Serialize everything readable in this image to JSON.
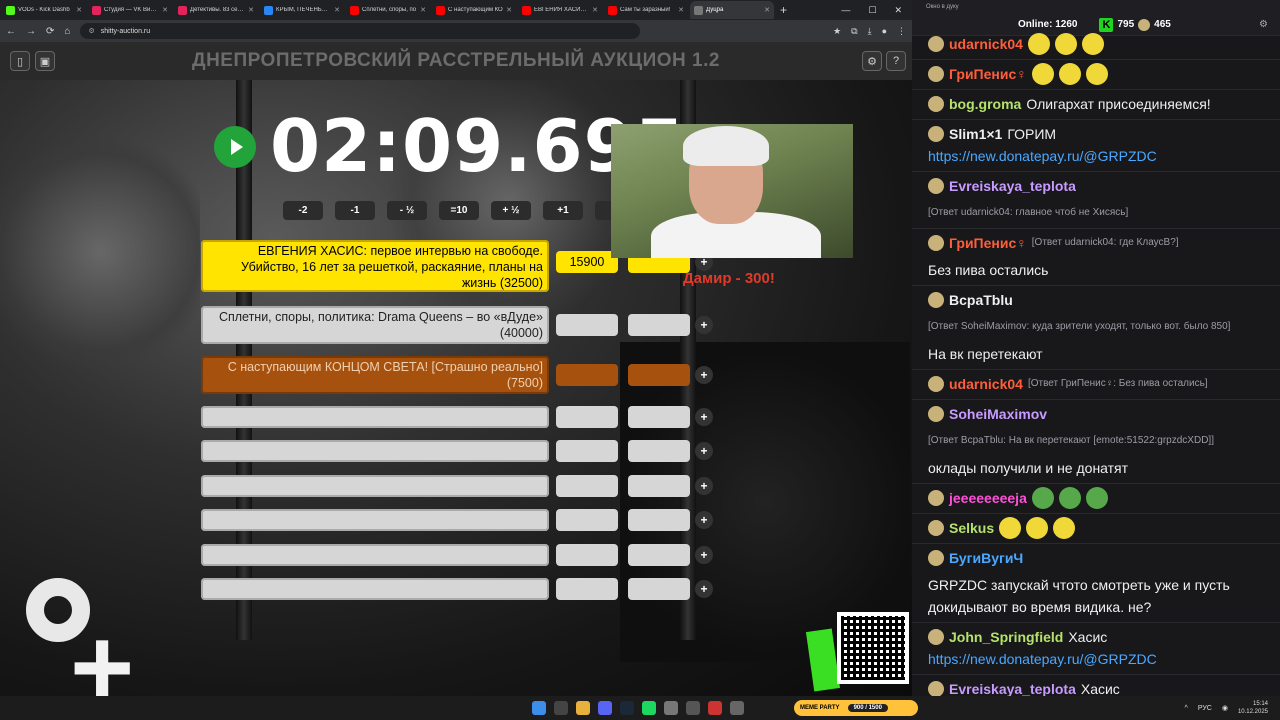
{
  "browser": {
    "tabs": [
      {
        "title": "VODs - Kick Dashb",
        "color": "#53fc18"
      },
      {
        "title": "Студия — VK Видео",
        "color": "#e3245c"
      },
      {
        "title": "Детективы. 83 серия",
        "color": "#e3245c"
      },
      {
        "title": "КРЫМ, ПЕЧЕНЬКИ В",
        "color": "#2787f5"
      },
      {
        "title": "Сплетни, споры, по",
        "color": "#ff0000"
      },
      {
        "title": "С наступающим КО",
        "color": "#ff0000"
      },
      {
        "title": "ЕВГЕНИЯ ХАСИС: п",
        "color": "#ff0000"
      },
      {
        "title": "Сам ты заразный!",
        "color": "#ff0000"
      },
      {
        "title": "Дуцра",
        "color": "#777777"
      }
    ],
    "url": "shitty-auction.ru"
  },
  "app": {
    "title": "ДНЕПРОПЕТРОВСКИЙ РАССТРЕЛЬНЫЙ АУКЦИОН 1.2",
    "timer": "02:09.695",
    "steps": [
      "-2",
      "-1",
      "- ½",
      "=10",
      "+ ½",
      "+1",
      "+"
    ],
    "overlay_text": "Дамир - 300!",
    "lots": [
      {
        "text": "ЕВГЕНИЯ ХАСИС: первое интервью на свободе. Убийство, 16 лет за решеткой, раскаяние, планы на жизнь (32500)",
        "amount": "15900",
        "style": "yellow"
      },
      {
        "text": "Сплетни, споры, политика: Drama Queens – во «вДуде» (40000)",
        "amount": "",
        "style": "grey"
      },
      {
        "text": "С наступающим КОНЦОМ СВЕТА! [Страшно реально] (7500)",
        "amount": "",
        "style": "brown"
      },
      {
        "text": "",
        "amount": "",
        "style": "grey"
      },
      {
        "text": "",
        "amount": "",
        "style": "grey"
      },
      {
        "text": "",
        "amount": "",
        "style": "grey"
      },
      {
        "text": "",
        "amount": "",
        "style": "grey"
      },
      {
        "text": "",
        "amount": "",
        "style": "grey"
      },
      {
        "text": "",
        "amount": "",
        "style": "grey"
      }
    ]
  },
  "chat": {
    "window_title": "Окно в дуку",
    "online_label": "Online: 1260",
    "kick_count": "795",
    "other_count": "465",
    "messages": [
      {
        "user": "udarnick04",
        "color": "#ff5e3a",
        "reply": "",
        "text": ""
      },
      {
        "user": "ГриПенис♀",
        "color": "#ff5e3a",
        "reply": "",
        "text": ""
      },
      {
        "user": "bog.groma",
        "color": "#b5e26a",
        "reply": "",
        "text": "Олигархат присоединяемся!"
      },
      {
        "user": "Slim1×1",
        "color": "#efeff1",
        "reply": "",
        "text": "ГОРИМ",
        "link": "https://new.donatepay.ru/@GRPZDC"
      },
      {
        "user": "Evreiskaya_teplota",
        "color": "#c79bff",
        "reply": "[Ответ udarnick04: главное чтоб не Хисясь]",
        "text": ""
      },
      {
        "user": "ГриПенис♀",
        "color": "#ff5e3a",
        "reply": "[Ответ udarnick04: где КлаусВ?]",
        "text": "Без пива остались"
      },
      {
        "user": "ВсраТblu",
        "color": "#efeff1",
        "reply": "[Ответ SoheiMaximov: куда зрители уходят, только вот. было 850]",
        "text": "На вк перетекают"
      },
      {
        "user": "udarnick04",
        "color": "#ff5e3a",
        "reply": "[Ответ ГриПенис♀: Без пива остались]",
        "text": ""
      },
      {
        "user": "SoheiMaximov",
        "color": "#c79bff",
        "reply": "[Ответ ВсраТblu: На вк перетекают [emote:51522:grpzdcXDD]]",
        "text": "оклады получили и не донатят"
      },
      {
        "user": "jeeeeeeeeja",
        "color": "#ff4fd8",
        "reply": "",
        "text": ""
      },
      {
        "user": "Selkus",
        "color": "#b5e26a",
        "reply": "",
        "text": ""
      },
      {
        "user": "БугиВугиЧ",
        "color": "#4aa8ff",
        "reply": "",
        "text": "GRPZDC запускай чтото смотреть уже и пусть докидывают во время видика. не?"
      },
      {
        "user": "John_Springfield",
        "color": "#b5e26a",
        "reply": "",
        "text": "Хасис",
        "link": "https://new.donatepay.ru/@GRPZDC"
      },
      {
        "user": "Evreiskaya_teplota",
        "color": "#c79bff",
        "reply": "",
        "text": "Хасис",
        "link": "https://new.donatepay.ru/@GRPZDC"
      }
    ]
  },
  "taskbar": {
    "memeparty_label": "MEME PARTY",
    "memeparty_progress": "900 / 1500",
    "lang": "РУС",
    "time": "15:14",
    "date": "10.12.2025"
  }
}
